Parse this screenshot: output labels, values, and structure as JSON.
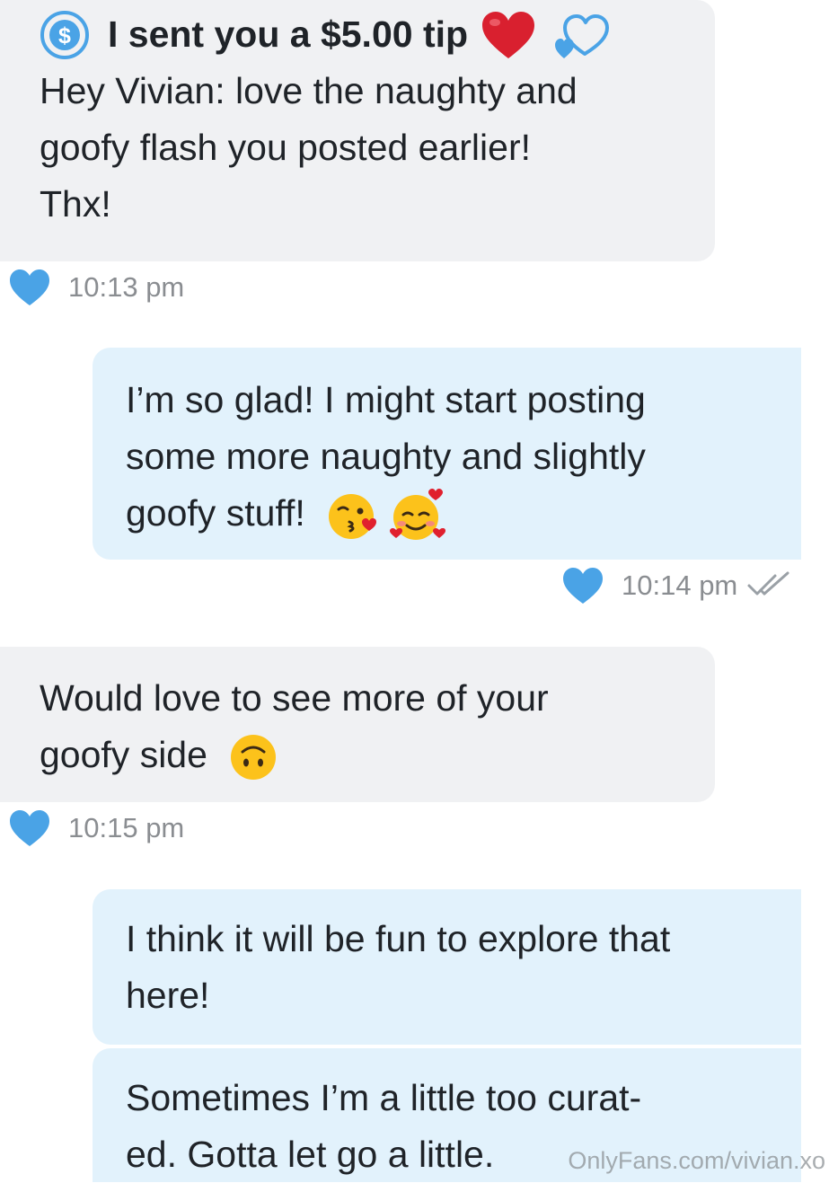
{
  "messages": [
    {
      "direction": "received",
      "tip_label": "I sent you a $5.00 tip",
      "lines": [
        "Hey Vivian: love the naughty and",
        "goofy flash you posted earlier!",
        "Thx!"
      ],
      "time": "10:13 pm"
    },
    {
      "direction": "sent",
      "lines": [
        "I’m so glad! I might start posting",
        "some more naughty and slightly",
        "goofy stuff!"
      ],
      "emojis": [
        "kissing-face-emoji",
        "smiling-face-with-hearts-emoji"
      ],
      "time": "10:14 pm",
      "status_icon": "double-check-icon"
    },
    {
      "direction": "received",
      "lines": [
        "Would love to see more of your",
        "goofy side"
      ],
      "emojis": [
        "upside-down-face-emoji"
      ],
      "time": "10:15 pm"
    },
    {
      "direction": "sent",
      "lines": [
        "I think it will be fun to explore that",
        "here!"
      ]
    },
    {
      "direction": "sent",
      "lines": [
        "Sometimes I’m a little too curat-",
        "ed. Gotta let go a little."
      ]
    }
  ],
  "watermark": "OnlyFans.com/vivian.xo",
  "colors": {
    "received_bubble": "#f0f1f3",
    "sent_bubble": "#e2f2fc",
    "accent_blue": "#4aa3e6",
    "red_heart": "#d9202f",
    "timestamp_gray": "#8a8d91"
  }
}
